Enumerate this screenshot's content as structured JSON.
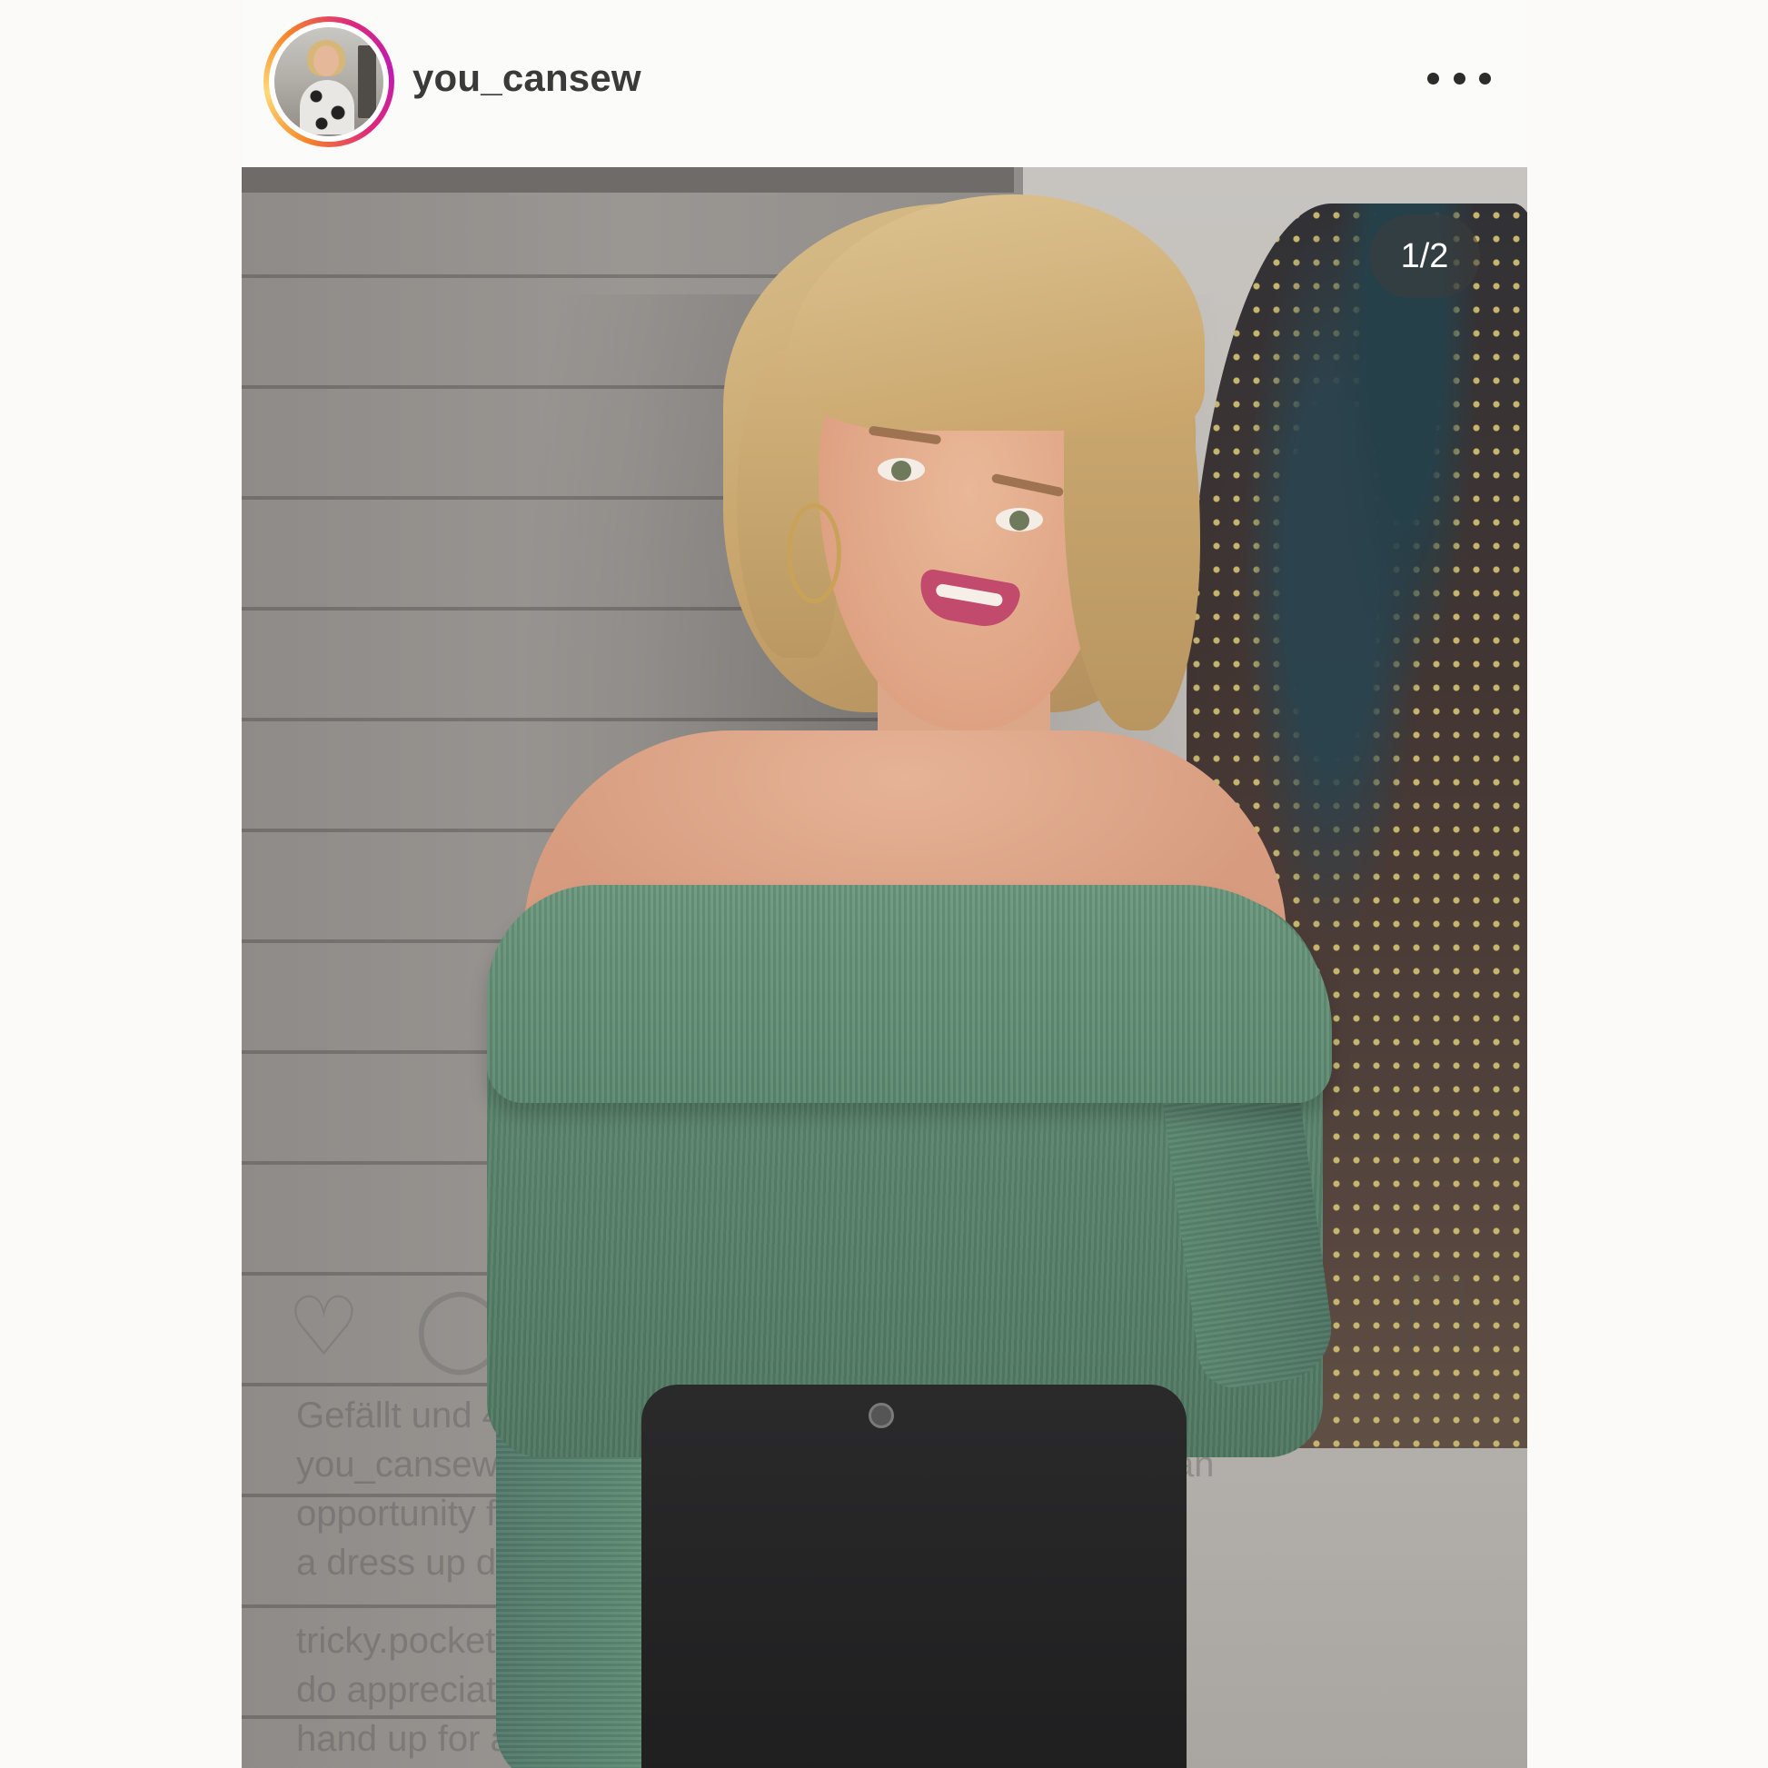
{
  "post": {
    "username": "you_cansew",
    "menu_icon": "more-horizontal-icon",
    "page_indicator": "1/2"
  },
  "ghost_overlay": {
    "likes_line": "Gefällt und 44 anderen Personen",
    "caption_lines": [
      "you_cansew I'm not a big Halloween fan, but I do love an",
      "opportunity for fancy dress, so when @ringwood put on",
      "a dress up do, I know I'm going to get crafty... mehr"
    ],
    "comment_lines": [
      "tricky.pocket I feel the same about Halloween but I",
      "do appreciate great costumes! Just putting my",
      "hand up for a too please. I'll be the purple"
    ],
    "icons": [
      "heart-icon",
      "comment-icon",
      "bookmark-icon"
    ]
  },
  "colors": {
    "story_ring_start": "#f58529",
    "story_ring_end": "#c01bb0",
    "sweater": "#5f8b72"
  }
}
